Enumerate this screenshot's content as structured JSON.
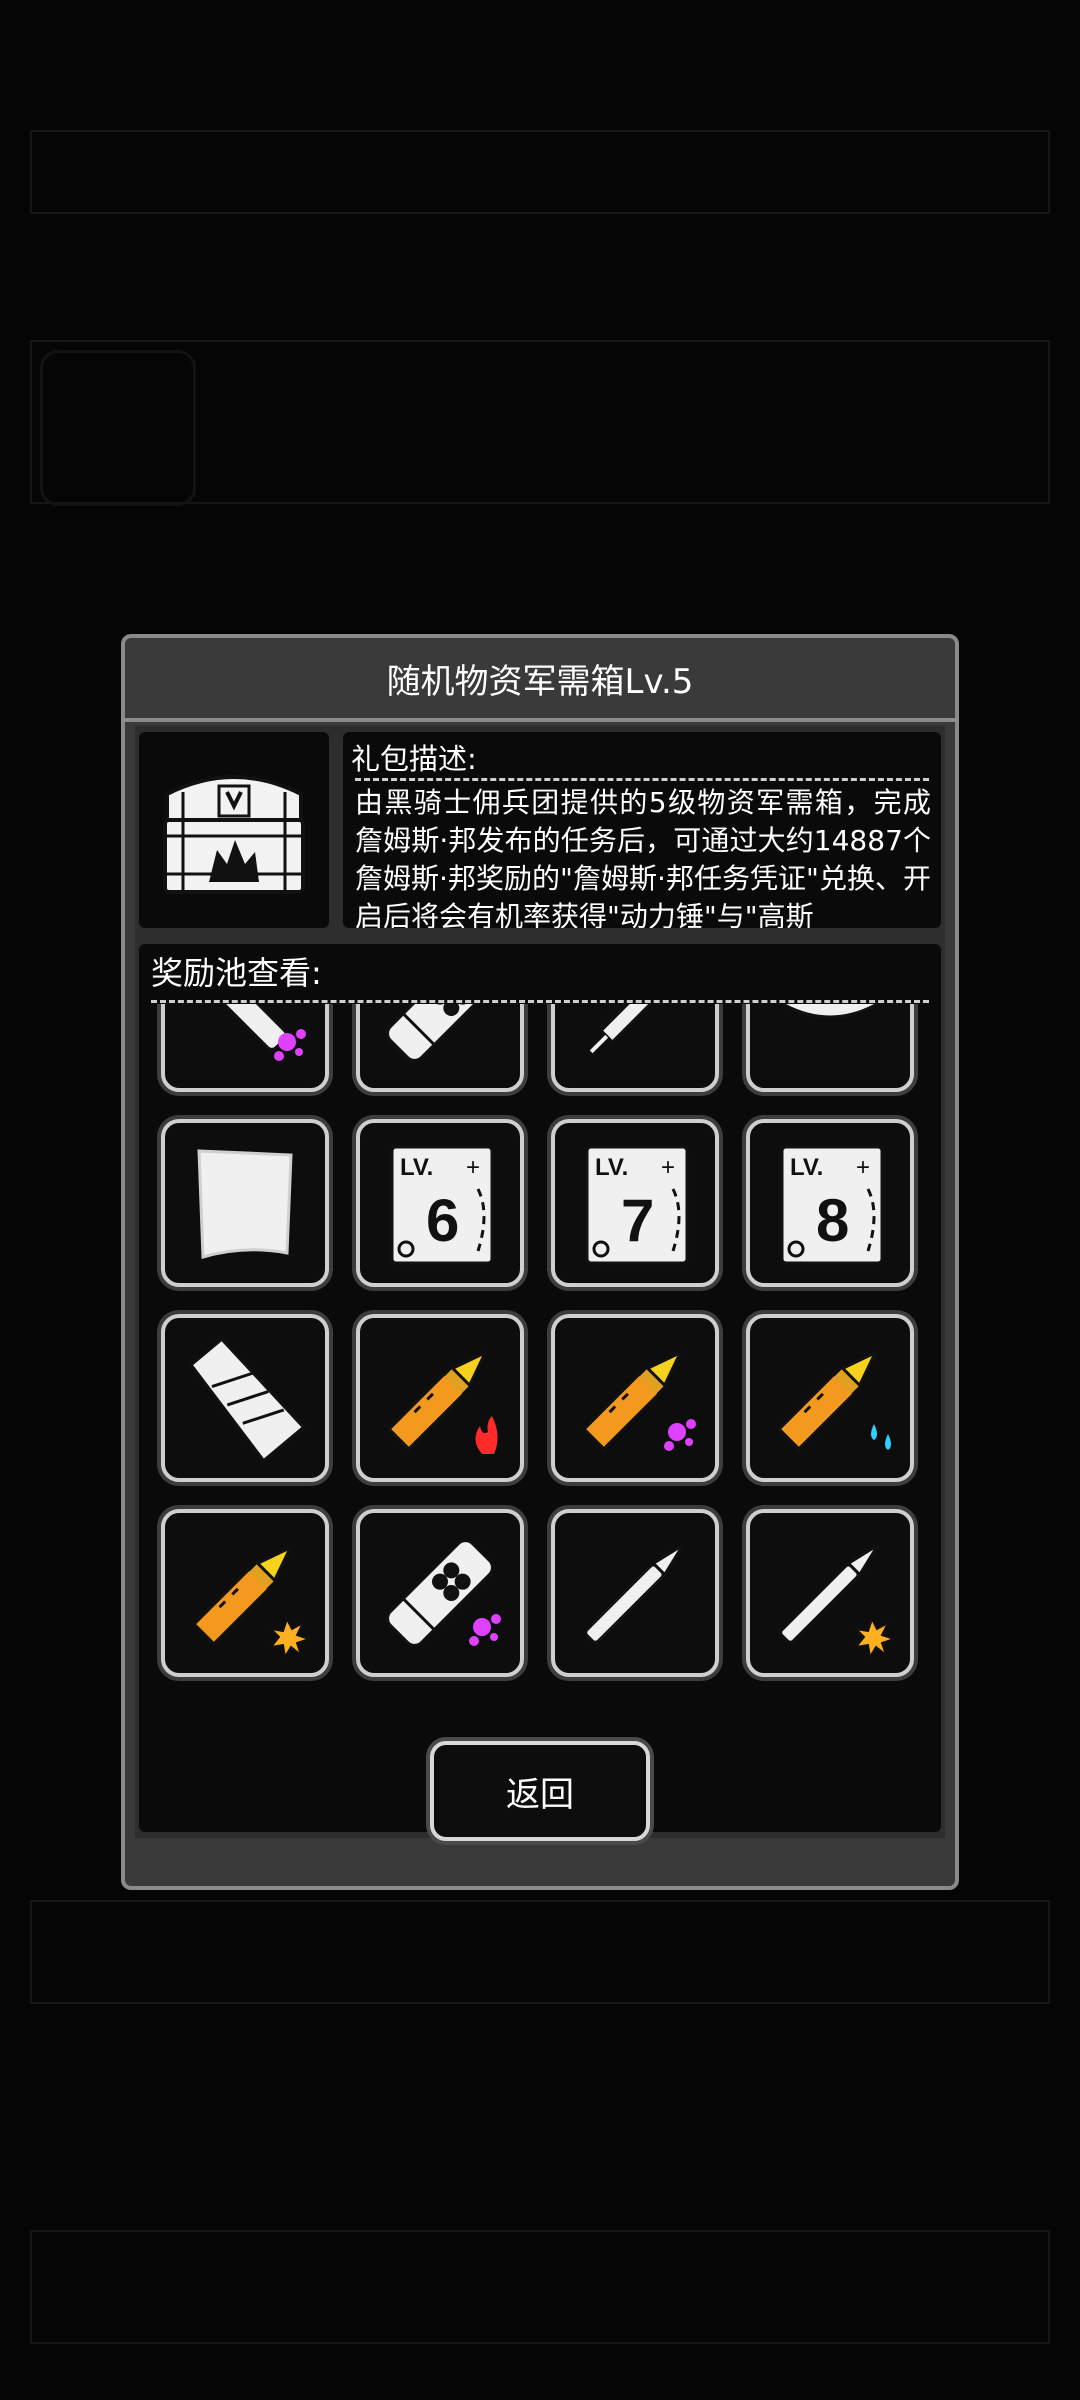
{
  "dialog": {
    "title": "随机物资军需箱Lv.5",
    "desc_label": "礼包描述:",
    "desc_text": "由黑骑士佣兵团提供的5级物资军需箱，完成詹姆斯·邦发布的任务后，可通过大约14887个詹姆斯·邦奖励的\"詹姆斯·邦任务凭证\"兑换、开启后将会有机率获得\"动力锤\"与\"高斯",
    "pool_label": "奖励池查看:",
    "back_label": "返回"
  },
  "rewards": [
    {
      "icon": "bullet-purple-splash-icon"
    },
    {
      "icon": "grenade-tube-icon"
    },
    {
      "icon": "syringe-icon"
    },
    {
      "icon": "bandage-roll-icon"
    },
    {
      "icon": "cloth-sheet-icon"
    },
    {
      "icon": "skill-book-lv6-icon",
      "level": "6"
    },
    {
      "icon": "skill-book-lv7-icon",
      "level": "7"
    },
    {
      "icon": "skill-book-lv8-icon",
      "level": "8"
    },
    {
      "icon": "magazine-clip-icon"
    },
    {
      "icon": "shell-fire-icon"
    },
    {
      "icon": "shell-purple-icon"
    },
    {
      "icon": "shell-water-icon"
    },
    {
      "icon": "shell-explosive-icon"
    },
    {
      "icon": "grenade-purple-icon"
    },
    {
      "icon": "rifle-bullet-icon"
    },
    {
      "icon": "rifle-bullet-explosive-icon"
    }
  ],
  "book_prefix": "LV.",
  "colors": {
    "dialog_bg": "#3a3a3a",
    "border": "#8a8a8a",
    "slot_bg": "#0d0d0d"
  }
}
